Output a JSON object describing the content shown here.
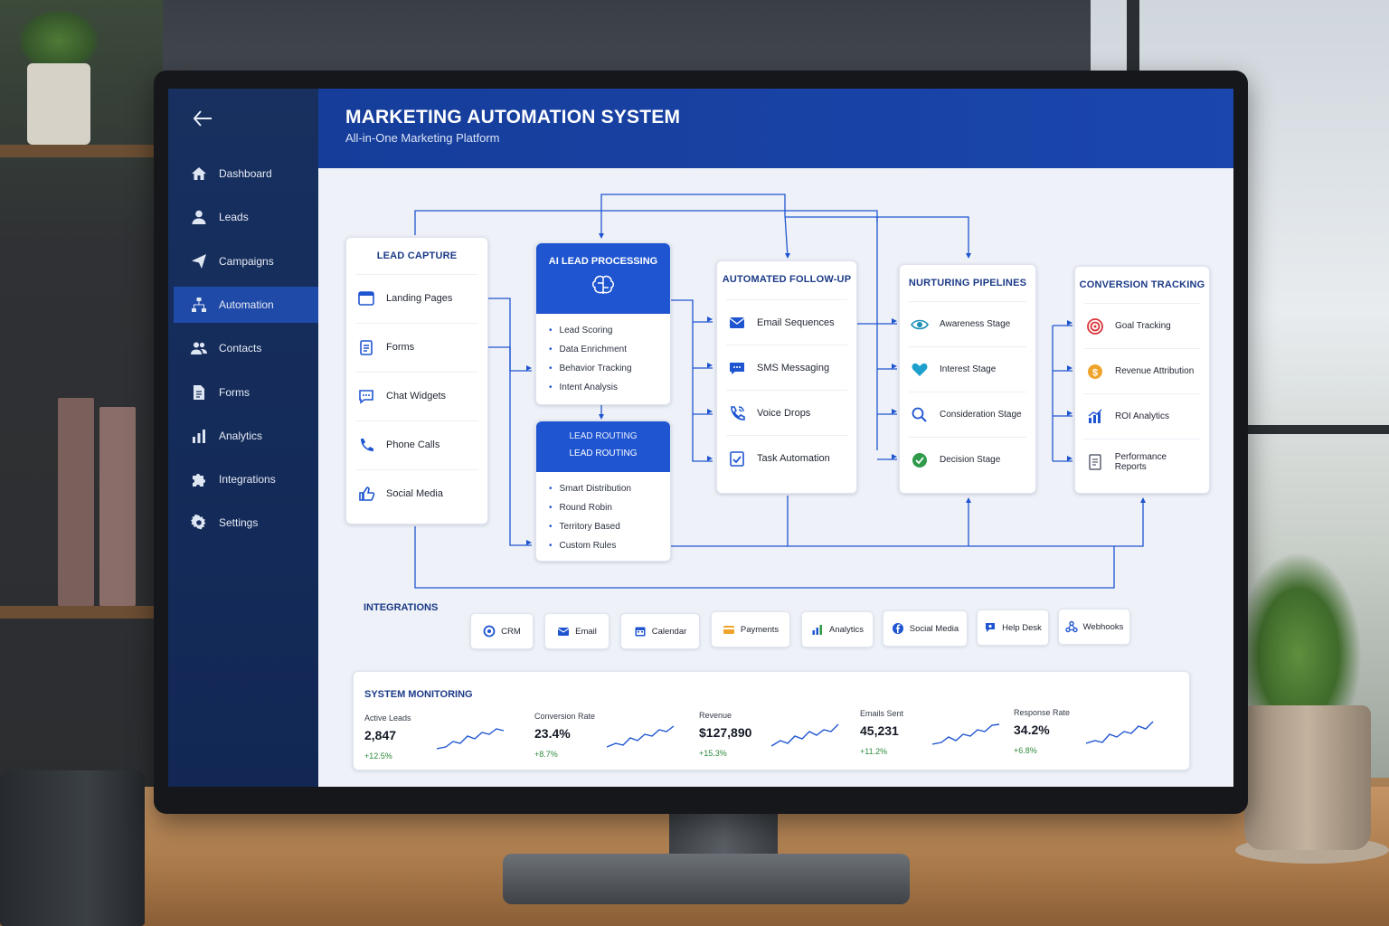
{
  "header": {
    "title": "MARKETING AUTOMATION SYSTEM",
    "subtitle": "All-in-One Marketing Platform"
  },
  "sidebar": {
    "back_icon": "arrow-left-icon",
    "items": [
      {
        "label": "Dashboard",
        "icon": "home-icon",
        "active": false
      },
      {
        "label": "Leads",
        "icon": "user-icon",
        "active": false
      },
      {
        "label": "Campaigns",
        "icon": "paper-plane-icon",
        "active": false
      },
      {
        "label": "Automation",
        "icon": "hierarchy-icon",
        "active": true
      },
      {
        "label": "Contacts",
        "icon": "users-icon",
        "active": false
      },
      {
        "label": "Forms",
        "icon": "document-icon",
        "active": false
      },
      {
        "label": "Analytics",
        "icon": "bar-chart-icon",
        "active": false
      },
      {
        "label": "Integrations",
        "icon": "puzzle-icon",
        "active": false
      },
      {
        "label": "Settings",
        "icon": "gear-icon",
        "active": false
      }
    ]
  },
  "lead_capture": {
    "title": "LEAD CAPTURE",
    "items": [
      "Landing Pages",
      "Forms",
      "Chat Widgets",
      "Phone Calls",
      "Social Media"
    ]
  },
  "ai_processing": {
    "title": "AI LEAD PROCESSING",
    "items": [
      "Lead Scoring",
      "Data Enrichment",
      "Behavior Tracking",
      "Intent Analysis"
    ]
  },
  "lead_routing": {
    "title_top": "LEAD ROUTING",
    "title": "LEAD ROUTING",
    "items": [
      "Smart Distribution",
      "Round Robin",
      "Territory Based",
      "Custom Rules"
    ]
  },
  "follow_up": {
    "title": "AUTOMATED FOLLOW-UP",
    "items": [
      "Email Sequences",
      "SMS Messaging",
      "Voice Drops",
      "Task Automation"
    ]
  },
  "nurturing": {
    "title": "NURTURING PIPELINES",
    "items": [
      "Awareness Stage",
      "Interest Stage",
      "Consideration Stage",
      "Decision Stage"
    ]
  },
  "conversion": {
    "title": "CONVERSION TRACKING",
    "items": [
      "Goal Tracking",
      "Revenue Attribution",
      "ROI Analytics",
      "Performance Reports"
    ]
  },
  "integrations": {
    "title": "INTEGRATIONS",
    "items": [
      "CRM",
      "Email",
      "Calendar",
      "Payments",
      "Analytics",
      "Social Media",
      "Help Desk",
      "Webhooks"
    ]
  },
  "monitoring": {
    "title": "SYSTEM MONITORING",
    "metrics": [
      {
        "label": "Active Leads",
        "value": "2,847",
        "change": "+12.5%"
      },
      {
        "label": "Conversion Rate",
        "value": "23.4%",
        "change": "+8.7%"
      },
      {
        "label": "Revenue",
        "value": "$127,890",
        "change": "+15.3%"
      },
      {
        "label": "Emails Sent",
        "value": "45,231",
        "change": "+11.2%"
      },
      {
        "label": "Response Rate",
        "value": "34.2%",
        "change": "+6.8%"
      }
    ]
  },
  "colors": {
    "sidebar": "#17305f",
    "active_nav": "#1f4aa8",
    "header": "#1a46ad",
    "accent": "#1f55d1",
    "positive": "#2e8b3d"
  }
}
